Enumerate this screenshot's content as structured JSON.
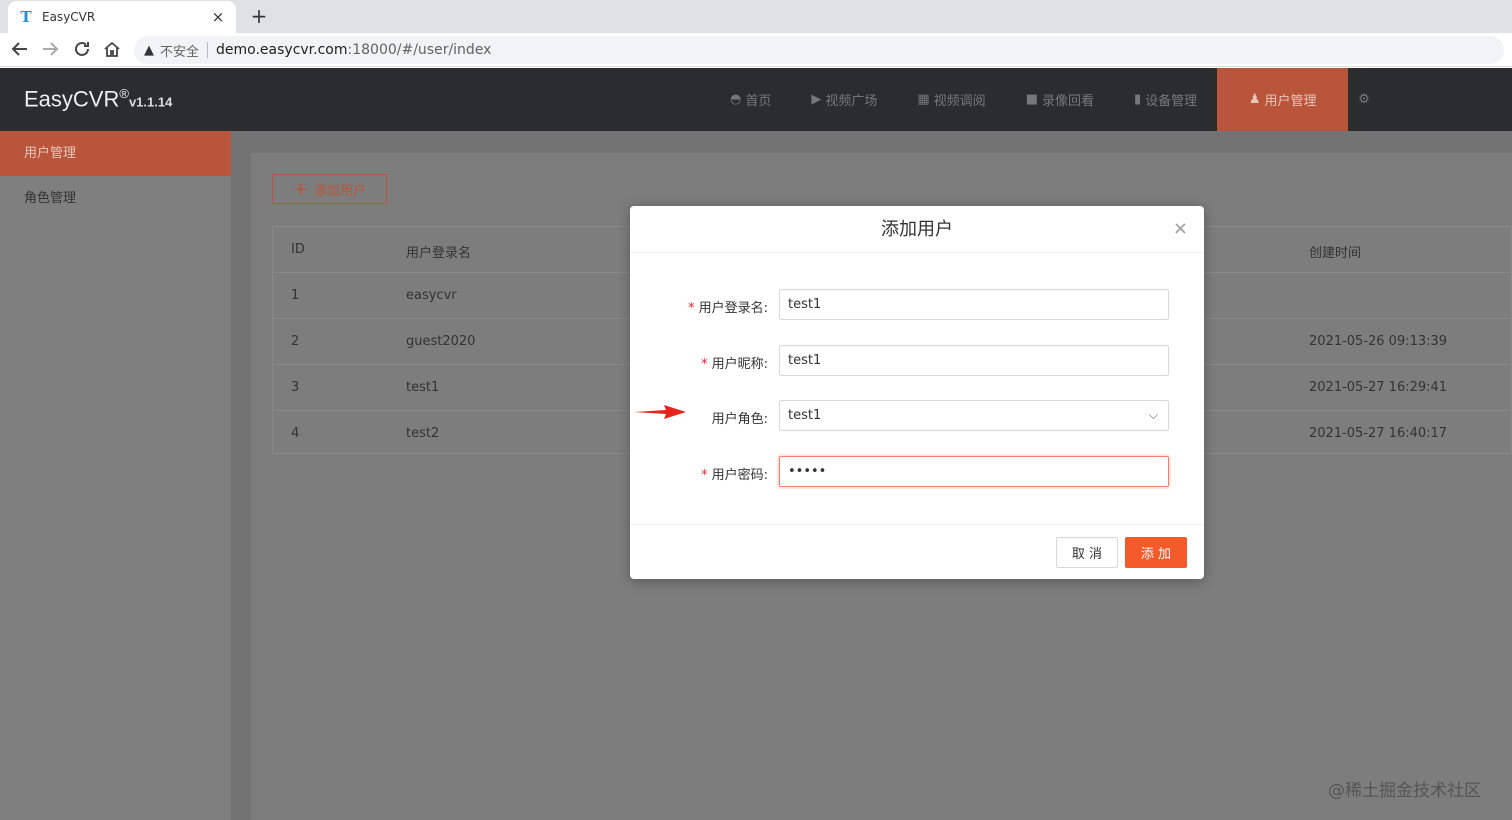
{
  "browser": {
    "tab_title": "EasyCVR",
    "tab_close": "×",
    "new_tab": "+",
    "insecure_label": "不安全",
    "url_host": "demo.easycvr.com",
    "url_path": ":18000/#/user/index"
  },
  "app": {
    "logo": "EasyCVR",
    "logo_mark": "®",
    "version": "v1.1.14"
  },
  "topnav": [
    {
      "label": "首页",
      "icon": "dashboard-icon"
    },
    {
      "label": "视频广场",
      "icon": "play-icon"
    },
    {
      "label": "视频调阅",
      "icon": "grid-icon"
    },
    {
      "label": "录像回看",
      "icon": "camera-icon"
    },
    {
      "label": "设备管理",
      "icon": "device-icon"
    },
    {
      "label": "用户管理",
      "icon": "user-icon",
      "active": true
    }
  ],
  "sidebar": [
    {
      "label": "用户管理",
      "active": true
    },
    {
      "label": "角色管理"
    }
  ],
  "main": {
    "add_button": "添加用户",
    "table": {
      "headers": [
        "ID",
        "用户登录名",
        "创建时间"
      ],
      "rows": [
        {
          "id": "1",
          "name": "easycvr",
          "created": ""
        },
        {
          "id": "2",
          "name": "guest2020",
          "created": "2021-05-26 09:13:39"
        },
        {
          "id": "3",
          "name": "test1",
          "created": "2021-05-27 16:29:41"
        },
        {
          "id": "4",
          "name": "test2",
          "created": "2021-05-27 16:40:17"
        }
      ]
    }
  },
  "modal": {
    "title": "添加用户",
    "close": "×",
    "fields": {
      "login": {
        "label": "用户登录名:",
        "value": "test1",
        "required": "*"
      },
      "nickname": {
        "label": "用户昵称:",
        "value": "test1",
        "required": "*"
      },
      "role": {
        "label": "用户角色:",
        "value": "test1"
      },
      "password": {
        "label": "用户密码:",
        "value": "•••••",
        "required": "*"
      }
    },
    "cancel": "取 消",
    "confirm": "添 加"
  },
  "watermark": "@稀土掘金技术社区",
  "colors": {
    "accent": "#b9553a",
    "primary_button": "#f55a2a",
    "arrow": "#e8231d"
  }
}
